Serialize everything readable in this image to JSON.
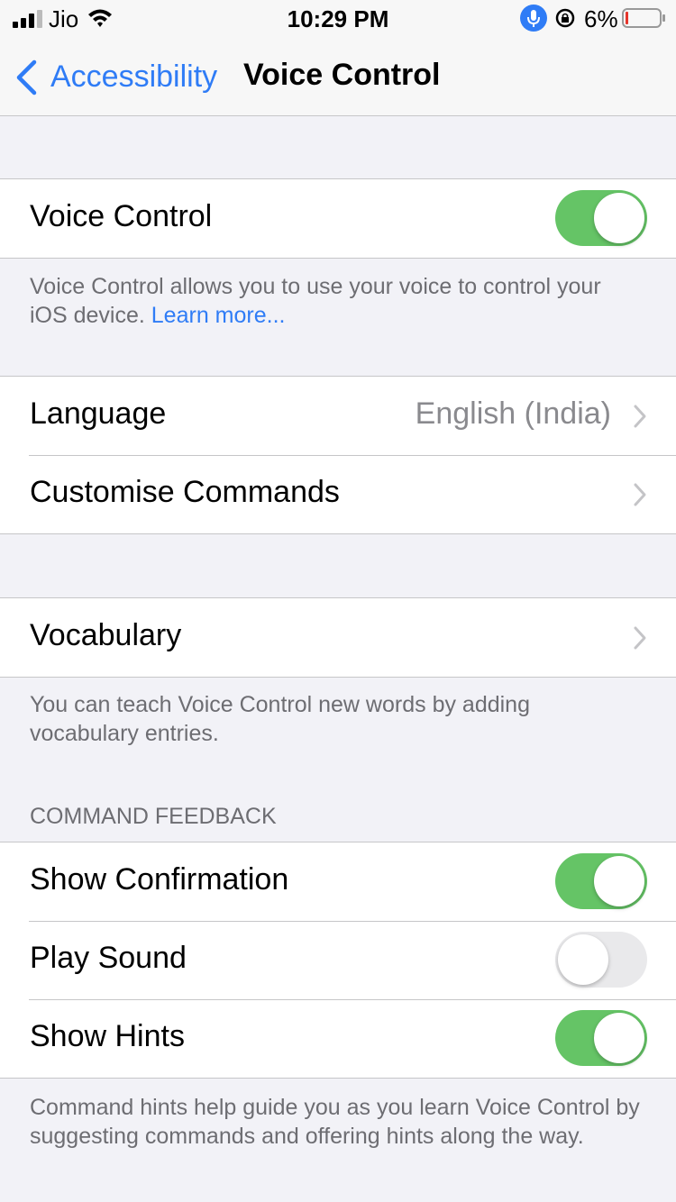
{
  "status_bar": {
    "carrier": "Jio",
    "time": "10:29 PM",
    "battery_percent": "6%",
    "icons": [
      "signal-icon",
      "wifi-icon",
      "microphone-icon",
      "rotation-lock-icon",
      "battery-icon"
    ]
  },
  "nav": {
    "back_label": "Accessibility",
    "title": "Voice Control"
  },
  "main_toggle": {
    "label": "Voice Control",
    "on": true
  },
  "main_footnote": {
    "text": "Voice Control allows you to use your voice to control your iOS device. ",
    "link": "Learn more..."
  },
  "settings": {
    "language_label": "Language",
    "language_value": "English (India)",
    "customise_label": "Customise Commands"
  },
  "vocabulary": {
    "label": "Vocabulary",
    "footnote": "You can teach Voice Control new words by adding vocabulary entries."
  },
  "command_feedback": {
    "header": "COMMAND FEEDBACK",
    "items": [
      {
        "label": "Show Confirmation",
        "on": true
      },
      {
        "label": "Play Sound",
        "on": false
      },
      {
        "label": "Show Hints",
        "on": true
      }
    ],
    "footnote": "Command hints help guide you as you learn Voice Control by suggesting commands and offering hints along the way."
  },
  "colors": {
    "accent": "#2f7cf6",
    "toggle_on": "#65c466",
    "toggle_off": "#e9e9eb",
    "background": "#f2f2f7"
  }
}
